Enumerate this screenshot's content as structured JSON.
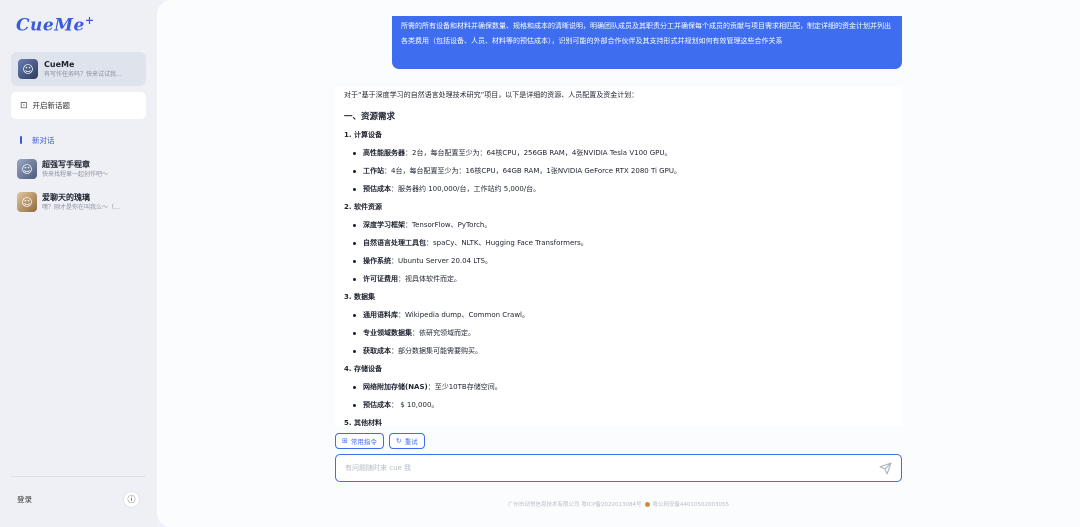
{
  "app": {
    "logo": "CueMe",
    "logo_mark": "+"
  },
  "sidebar": {
    "agent": {
      "name": "CueMe",
      "subtitle": "有写作任务吗？快来试试我..."
    },
    "new_topic_label": "开启新话题",
    "current_chat_label": "新对话",
    "conversations": [
      {
        "title": "超强写手程章",
        "subtitle": "快来找程章一起创作吧～"
      },
      {
        "title": "爱聊天的瑰璃",
        "subtitle": "嘿？刚才是你在叫我么～（..."
      }
    ],
    "login_label": "登录",
    "info_icon": "info-icon"
  },
  "chat": {
    "user_message": "所需的所有设备和材料并确保数量、规格和成本的清晰说明，明确团队成员及其职责分工并确保每个成员的贡献与项目需求相匹配，制定详细的资金计划并列出各类费用（包括设备、人员、材料等的预估成本），识别可能的外部合作伙伴及其支持形式并规划如何有效管理这些合作关系",
    "answer": {
      "intro": "对于“基于深度学习的自然语言处理技术研究”项目，以下是详细的资源、人员配置及资金计划：",
      "section_title": "一、资源需求",
      "groups": [
        {
          "title": "1. 计算设备",
          "items": [
            {
              "label": "高性能服务器",
              "text": "：2台，每台配置至少为：64核CPU，256GB RAM，4张NVIDIA Tesla V100 GPU。"
            },
            {
              "label": "工作站",
              "text": "：4台，每台配置至少为：16核CPU，64GB RAM，1张NVIDIA GeForce RTX 2080 Ti GPU。"
            },
            {
              "label": "预估成本",
              "text": "：服务器约 100,000/台，工作站约 5,000/台。"
            }
          ]
        },
        {
          "title": "2. 软件资源",
          "items": [
            {
              "label": "深度学习框架",
              "text": "：TensorFlow、PyTorch。"
            },
            {
              "label": "自然语言处理工具包",
              "text": "：spaCy、NLTK、Hugging Face Transformers。"
            },
            {
              "label": "操作系统",
              "text": "：Ubuntu Server 20.04 LTS。"
            },
            {
              "label": "许可证费用",
              "text": "：视具体软件而定。"
            }
          ]
        },
        {
          "title": "3. 数据集",
          "items": [
            {
              "label": "通用语料库",
              "text": "：Wikipedia dump、Common Crawl。"
            },
            {
              "label": "专业领域数据集",
              "text": "：依研究领域而定。"
            },
            {
              "label": "获取成本",
              "text": "：部分数据集可能需要购买。"
            }
          ]
        },
        {
          "title": "4. 存储设备",
          "items": [
            {
              "label": "网络附加存储(NAS)",
              "text": "：至少10TB存储空间。"
            },
            {
              "label": "预估成本",
              "text": "： $ 10,000。"
            }
          ]
        },
        {
          "title": "5. 其他材料",
          "items": []
        }
      ]
    },
    "chips": [
      {
        "label": "常用指令",
        "icon": "command-icon"
      },
      {
        "label": "重试",
        "icon": "retry-icon"
      }
    ],
    "input_placeholder": "有问题随时来 cue 我",
    "send_icon": "send-icon",
    "footer": {
      "company": "广州市动悦信息技术有限公司 粤ICP备2022013084号",
      "police": "粤公网安备44010502003055"
    },
    "accent_color": "#3f6df0"
  }
}
